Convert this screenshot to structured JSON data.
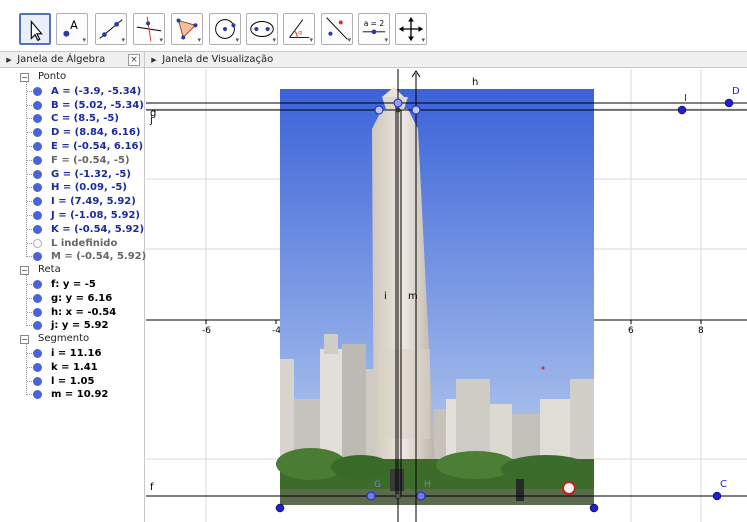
{
  "toolbar": {
    "tools": [
      {
        "name": "move-tool",
        "icon": "cursor-arrow-icon",
        "active": true
      },
      {
        "name": "point-tool",
        "icon": "point-icon",
        "glyph": "A"
      },
      {
        "name": "line-tool",
        "icon": "line-through-points-icon"
      },
      {
        "name": "perpendicular-line-tool",
        "icon": "perpendicular-line-icon"
      },
      {
        "name": "polygon-tool",
        "icon": "polygon-icon"
      },
      {
        "name": "circle-tool",
        "icon": "circle-center-point-icon"
      },
      {
        "name": "conic-tool",
        "icon": "ellipse-icon"
      },
      {
        "name": "angle-tool",
        "icon": "angle-icon",
        "glyph": "α"
      },
      {
        "name": "reflect-tool",
        "icon": "reflect-about-line-icon"
      },
      {
        "name": "slider-tool",
        "icon": "slider-icon",
        "glyph": "a = 2"
      },
      {
        "name": "move-graphics-view-tool",
        "icon": "move-view-icon"
      }
    ]
  },
  "algebra_view": {
    "title": "Janela de Álgebra",
    "close_glyph": "×",
    "groups": [
      {
        "label": "Ponto",
        "items": [
          {
            "text": "A = (-3.9, -5.34)",
            "style": "blue",
            "dot": "filled"
          },
          {
            "text": "B = (5.02, -5.34)",
            "style": "blue",
            "dot": "filled"
          },
          {
            "text": "C = (8.5, -5)",
            "style": "blue",
            "dot": "filled"
          },
          {
            "text": "D = (8.84, 6.16)",
            "style": "blue",
            "dot": "filled"
          },
          {
            "text": "E = (-0.54, 6.16)",
            "style": "blue",
            "dot": "filled"
          },
          {
            "text": "F = (-0.54, -5)",
            "style": "grey",
            "dot": "filled"
          },
          {
            "text": "G = (-1.32, -5)",
            "style": "blue",
            "dot": "filled"
          },
          {
            "text": "H = (0.09, -5)",
            "style": "blue",
            "dot": "filled"
          },
          {
            "text": "I = (7.49, 5.92)",
            "style": "blue",
            "dot": "filled"
          },
          {
            "text": "J = (-1.08, 5.92)",
            "style": "blue",
            "dot": "filled"
          },
          {
            "text": "K = (-0.54, 5.92)",
            "style": "blue",
            "dot": "filled"
          },
          {
            "text": "L indefinido",
            "style": "grey",
            "dot": "hollow"
          },
          {
            "text": "M = (-0.54, 5.92)",
            "style": "grey",
            "dot": "filled"
          }
        ]
      },
      {
        "label": "Reta",
        "items": [
          {
            "text": "f: y = -5",
            "style": "black",
            "dot": "filled"
          },
          {
            "text": "g: y = 6.16",
            "style": "black",
            "dot": "filled"
          },
          {
            "text": "h: x = -0.54",
            "style": "black",
            "dot": "filled"
          },
          {
            "text": "j: y = 5.92",
            "style": "black",
            "dot": "filled"
          }
        ]
      },
      {
        "label": "Segmento",
        "items": [
          {
            "text": "i = 11.16",
            "style": "black",
            "dot": "filled"
          },
          {
            "text": "k = 1.41",
            "style": "black",
            "dot": "filled"
          },
          {
            "text": "l = 1.05",
            "style": "black",
            "dot": "filled"
          },
          {
            "text": "m = 10.92",
            "style": "black",
            "dot": "filled"
          }
        ]
      }
    ]
  },
  "graphics_view": {
    "title": "Janela de Visualização",
    "x_tick_labels": [
      "-6",
      "-4",
      "6",
      "8"
    ],
    "object_labels": {
      "h": "h",
      "g": "g",
      "j": "j",
      "f": "f",
      "i": "i",
      "m": "m",
      "C": "C",
      "D": "D",
      "I": "I",
      "G": "G",
      "H": "H"
    },
    "colors": {
      "point": "#1f1fd6",
      "point_light": "#6f7fe0",
      "line": "#000000",
      "grid": "#d0d0d0",
      "sky_top": "#3b63d8",
      "sky_bottom": "#b8c8e8",
      "trees": "#3d6b2a"
    },
    "photo_subject": "obelisk-photo"
  }
}
